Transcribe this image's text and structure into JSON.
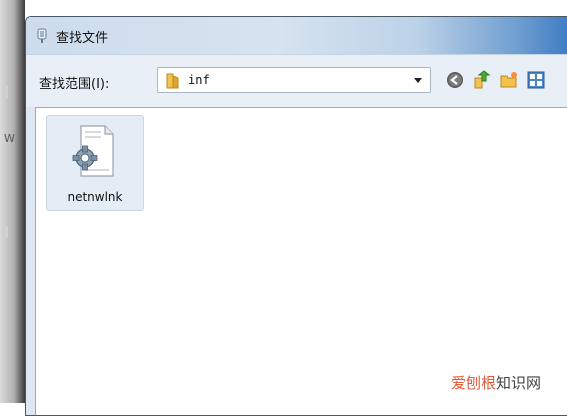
{
  "window": {
    "title": "查找文件"
  },
  "toolbar": {
    "look_in_label": "查找范围(I):",
    "look_in_value": "inf",
    "back_icon": "back-arrow-icon",
    "up_icon": "up-folder-icon",
    "new_folder_icon": "new-folder-icon",
    "view_icon": "view-menu-icon"
  },
  "files": [
    {
      "name": "netnwlnk",
      "icon": "inf-settings-file-icon"
    }
  ],
  "backdrop": {
    "stray_letter": "W"
  },
  "watermark": {
    "brand": "爱刨根",
    "suffix": "知识网"
  },
  "colors": {
    "title_gradient_end": "#2f72c0",
    "selection_bg": "#e4ecf6",
    "watermark_brand": "#e05a3a"
  }
}
